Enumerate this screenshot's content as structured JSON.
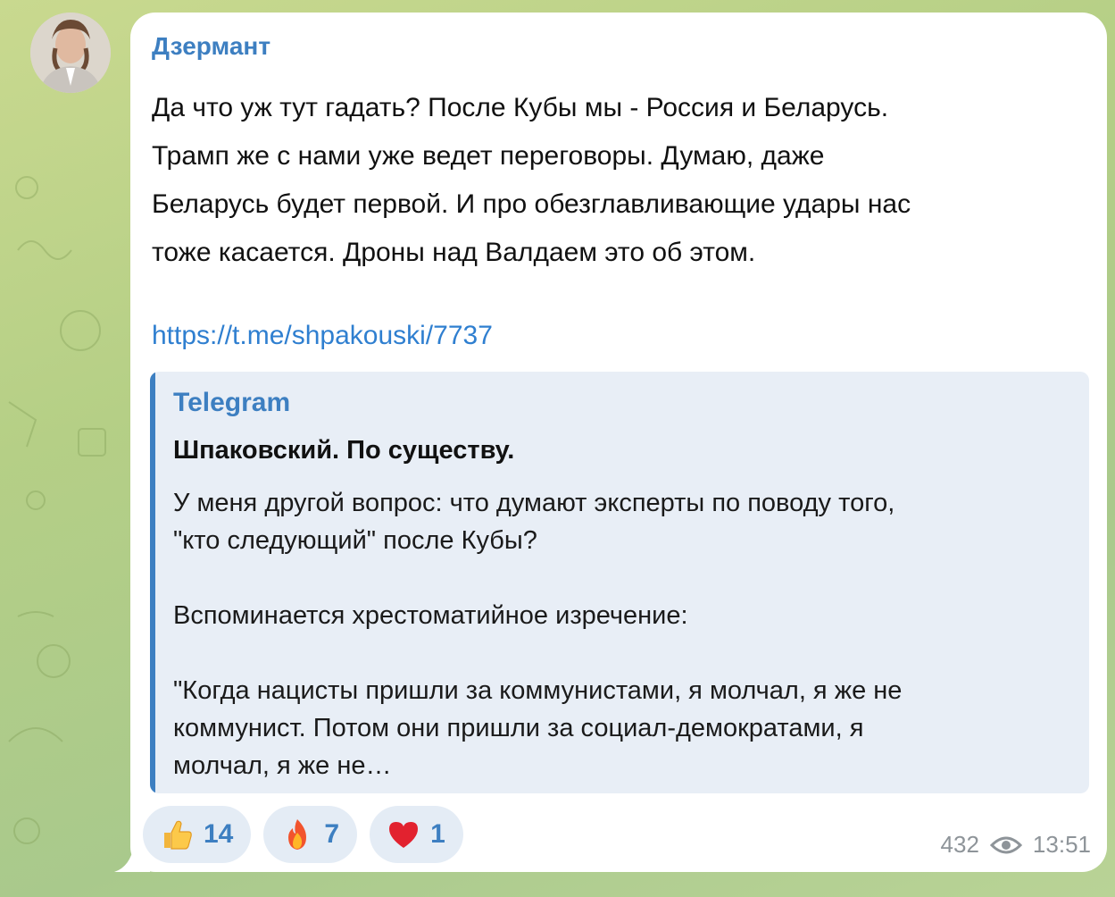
{
  "message": {
    "sender": "Дзермант",
    "text_lines": [
      "Да что уж тут гадать? После Кубы мы - Россия и Беларусь.",
      "Трамп же с нами уже ведет переговоры. Думаю, даже",
      "Беларусь будет первой. И про обезглавливающие удары нас",
      "тоже касается. Дроны над Валдаем это об этом."
    ],
    "link": "https://t.me/shpakouski/7737"
  },
  "preview": {
    "site": "Telegram",
    "title": "Шпаковский. По существу.",
    "description": "У меня другой вопрос: что думают эксперты по поводу того,\n\"кто следующий\" после Кубы?\n\nВспоминается хрестоматийное изречение:\n\n\"Когда нацисты пришли за коммунистами, я молчал, я же не\nкоммунист. Потом они пришли за социал-демократами, я\nмолчал, я же не…"
  },
  "reactions": [
    {
      "icon": "thumbs-up-icon",
      "count": "14"
    },
    {
      "icon": "fire-icon",
      "count": "7"
    },
    {
      "icon": "red-heart-icon",
      "count": "1"
    }
  ],
  "meta": {
    "views": "432",
    "time": "13:51"
  },
  "colors": {
    "accent": "#3d7fc1",
    "link": "#2f7fd0",
    "preview_bg": "#e8eef6",
    "reaction_bg": "#e4ecf5",
    "meta_text": "#8e9499",
    "chat_bg": "#b5cf86"
  }
}
